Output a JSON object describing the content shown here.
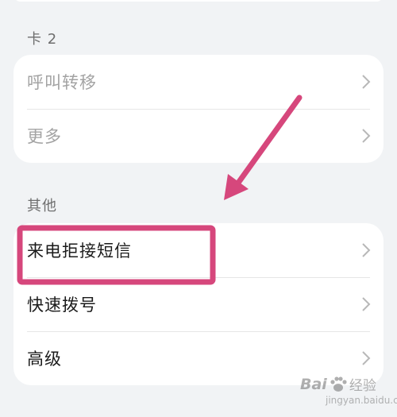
{
  "sections": [
    {
      "title": "卡 2",
      "items": [
        {
          "label": "呼叫转移",
          "enabled": false
        },
        {
          "label": "更多",
          "enabled": false
        }
      ]
    },
    {
      "title": "其他",
      "items": [
        {
          "label": "来电拒接短信",
          "enabled": true,
          "highlighted": true
        },
        {
          "label": "快速拨号",
          "enabled": true
        },
        {
          "label": "高级",
          "enabled": true
        }
      ]
    }
  ],
  "annotation": {
    "highlight_color": "#d6477c",
    "arrow_color": "#d6477c"
  },
  "watermark": {
    "brand": "Bai",
    "brand_suffix": "经验",
    "url": "jingyan.baidu.com"
  },
  "colors": {
    "background": "#f1f3f5",
    "card": "#ffffff",
    "disabled_text": "#a3a3a3",
    "text": "#1b1b1b",
    "chevron": "#b8b8b8"
  }
}
